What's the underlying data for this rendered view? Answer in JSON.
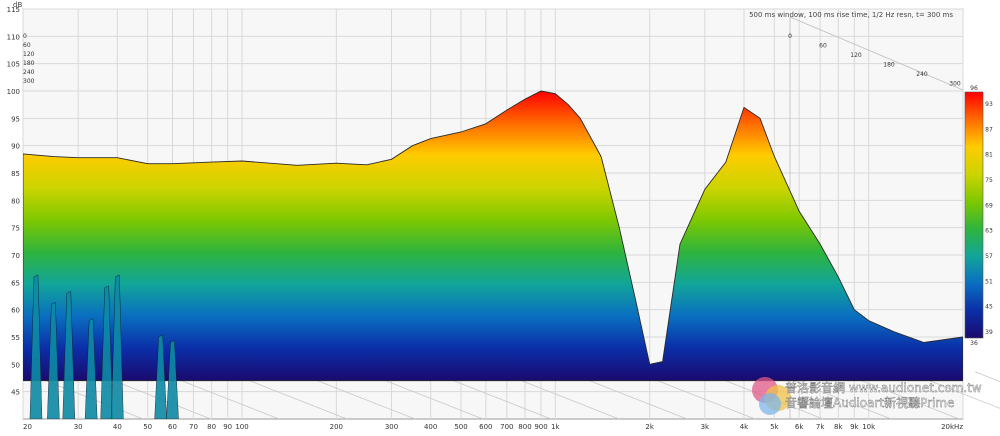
{
  "chart_data": {
    "type": "area",
    "title": "500 ms window, 100 ms rise time, 1/2 Hz resn, t= 300 ms",
    "y_unit": "dB",
    "x_unit_label": "20kHz",
    "ylim": [
      40,
      115
    ],
    "xlim": [
      20,
      20000
    ],
    "x_scale": "log",
    "grid": true,
    "y_ticks": [
      "45",
      "50",
      "55",
      "60",
      "65",
      "70",
      "75",
      "80",
      "85",
      "90",
      "95",
      "100",
      "105",
      "110",
      "115"
    ],
    "x_ticks": [
      {
        "v": 20,
        "label": "20"
      },
      {
        "v": 30,
        "label": "30"
      },
      {
        "v": 40,
        "label": "40"
      },
      {
        "v": 50,
        "label": "50"
      },
      {
        "v": 60,
        "label": "60"
      },
      {
        "v": 70,
        "label": "70"
      },
      {
        "v": 80,
        "label": "80"
      },
      {
        "v": 90,
        "label": "90"
      },
      {
        "v": 100,
        "label": "100"
      },
      {
        "v": 200,
        "label": "200"
      },
      {
        "v": 300,
        "label": "300"
      },
      {
        "v": 400,
        "label": "400"
      },
      {
        "v": 500,
        "label": "500"
      },
      {
        "v": 600,
        "label": "600"
      },
      {
        "v": 700,
        "label": "700"
      },
      {
        "v": 800,
        "label": "800"
      },
      {
        "v": 900,
        "label": "900"
      },
      {
        "v": 1000,
        "label": "1k"
      },
      {
        "v": 2000,
        "label": "2k"
      },
      {
        "v": 3000,
        "label": "3k"
      },
      {
        "v": 4000,
        "label": "4k"
      },
      {
        "v": 5000,
        "label": "5k"
      },
      {
        "v": 6000,
        "label": "6k"
      },
      {
        "v": 7000,
        "label": "7k"
      },
      {
        "v": 8000,
        "label": "8k"
      },
      {
        "v": 9000,
        "label": "9k"
      },
      {
        "v": 10000,
        "label": "10k"
      },
      {
        "v": 20000,
        "label": "20kHz"
      }
    ],
    "time_axis_left": [
      "0",
      "60",
      "120",
      "180",
      "240",
      "300"
    ],
    "time_axis_right": [
      "0",
      "60",
      "120",
      "180",
      "240",
      "300"
    ],
    "colorbar": {
      "min_label": "36",
      "max_label": "96",
      "ticks": [
        "93",
        "87",
        "81",
        "75",
        "69",
        "63",
        "57",
        "51",
        "45",
        "39"
      ],
      "colors": [
        "#ff0000",
        "#ff6a00",
        "#ffcc00",
        "#ccd400",
        "#7fc800",
        "#2fb43c",
        "#12a59a",
        "#0a6ec0",
        "#0b2ea8",
        "#1a0a6e"
      ]
    },
    "series": [
      {
        "time_ms": 0,
        "x": [
          20,
          25,
          30,
          40,
          50,
          60,
          80,
          100,
          150,
          200,
          250,
          300,
          350,
          400,
          500,
          600,
          700,
          800,
          900,
          1000,
          1100,
          1200,
          1400,
          1600,
          1800,
          2000,
          2200,
          2500,
          3000,
          3500,
          4000,
          4500,
          5000,
          6000,
          7000,
          8000,
          9000,
          10000,
          12000,
          15000,
          20000
        ],
        "values": [
          88.5,
          88.0,
          87.8,
          87.8,
          86.7,
          86.7,
          87.0,
          87.2,
          86.4,
          86.8,
          86.5,
          87.5,
          90.0,
          91.3,
          92.5,
          94.0,
          96.5,
          98.5,
          100.0,
          99.5,
          97.5,
          95.0,
          88.0,
          75.0,
          62.0,
          50.0,
          50.5,
          72.0,
          82.0,
          87.0,
          97.0,
          95.0,
          88.0,
          78.0,
          72.0,
          66.0,
          60.0,
          58.0,
          56.0,
          54.0,
          55.0
        ]
      }
    ]
  },
  "watermark": {
    "line1": "普洛影音網 www.audionet.com.tw",
    "line2": "音響論壇Audioart新視聽Prime"
  }
}
